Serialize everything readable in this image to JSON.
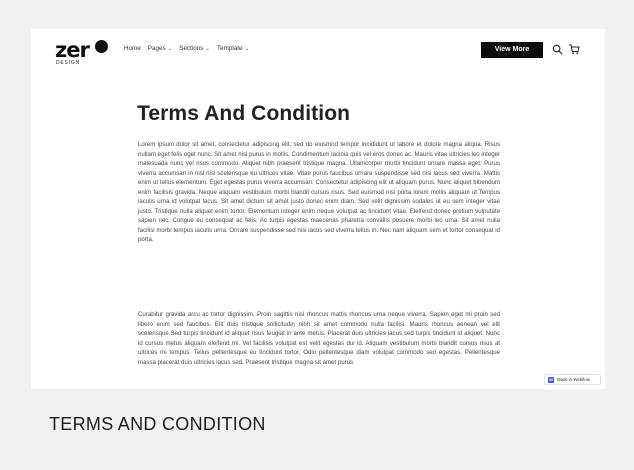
{
  "header": {
    "logo_word": "zer",
    "logo_sub": "DESIGN",
    "menu": [
      {
        "label": "Home",
        "dropdown": false
      },
      {
        "label": "Pages",
        "dropdown": true
      },
      {
        "label": "Sections",
        "dropdown": true
      },
      {
        "label": "Template",
        "dropdown": true
      }
    ],
    "cta_label": "View More",
    "icons": [
      "search-icon",
      "cart-icon"
    ]
  },
  "main": {
    "title": "Terms And Condition",
    "paragraph_1": "Lorem ipsum dolor sit amet, consectetur adipiscing elit, sed do eiusmod tempor incididunt ut labore et dolore magna aliqua. Risus nullam eget felis eget nunc. Sit amet nisl purus in mollis. Condimentum lacinia quis vel eros donec ac. Mauris vitae ultricies leo integer malesuada nunc vel risus commodo. Aliquet nibh praesent tristique magna. Ullamcorper morbi tincidunt ornare massa eget. Purus viverra accumsan in nisl nisi scelerisque eu ultrices vitae. Vitae purus faucibus ornare suspendisse sed nisi lacus sed viverra. Mattis enim ut tellus elementum. Eget egestas purus viverra accumsan. Consectetur adipiscing elit ut aliquam purus. Nunc aliquet bibendum enim facilisis gravida. Neque aliquam vestibulum morbi blandit cursus risus. Sed euismod nisi porta lorem mollis aliquam ut.Tempus iaculis urna id volutpat lacus. Sit amet dictum sit amet justo donec enim diam. Sed velit dignissim sodales ut eu sem integer vitae justo. Tristique nulla aliquet enim tortor. Elementum integer enim neque volutpat ac tincidunt vitae. Eleifend donec pretium vulputate sapien nec. Congue eu consequat ac felis. Ac turpis egestas maecenas pharetra convallis posuere morbi leo urna. Sit amet nulla facilisi morbi tempus iaculis urna. Ornare suspendisse sed nisi lacus sed viverra tellus in. Nec nam aliquam sem et tortor consequat id porta.",
    "paragraph_2": "Curabitur gravida arcu ac tortor dignissim. Proin sagittis nisl rhoncus mattis rhoncus urna neque viverra. Sapien eget mi proin sed libero enim sed faucibus. Elit duis tristique sollicitudin nibh sit amet commodo nulla facilisi. Mauris rhoncus aenean vel elit scelerisque.Sed turpis tincidunt id aliquet risus feugiat in ante metus. Placerat duis ultricies lacus sed turpis tincidunt id aliquet. Nunc id cursus metus aliquam eleifend mi. Vel facilisis volutpat est velit egestas dui id. Aliquam vestibulum morbi blandit cursus risus at ultrices mi tempus. Tellus pellentesque eu tincidunt tortor. Odio pellentesque diam volutpat commodo sed egestas. Pellentesque massa placerat duis ultricies lacus sed. Praesent tristique magna sit amet purus"
  },
  "badge": {
    "label": "Made in Webflow",
    "glyph": "W"
  },
  "caption": "TERMS AND CONDITION"
}
